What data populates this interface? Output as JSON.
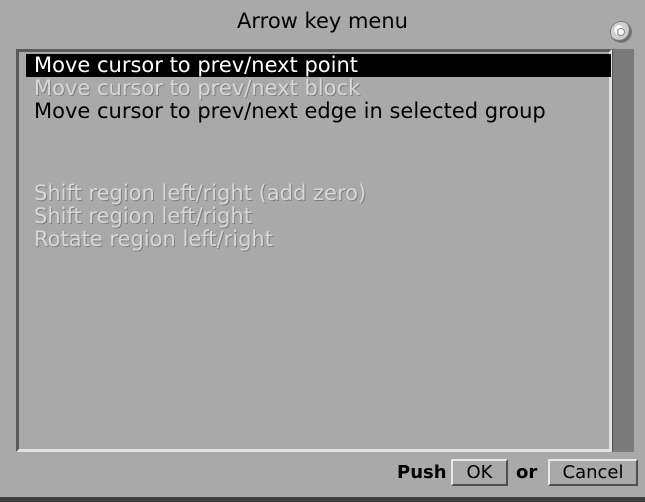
{
  "window": {
    "title": "Arrow key menu"
  },
  "menu": {
    "items": [
      {
        "label": "Move cursor to prev/next point",
        "state": "selected"
      },
      {
        "label": "Move cursor to prev/next block",
        "state": "disabled"
      },
      {
        "label": "Move cursor to prev/next edge in selected group",
        "state": "enabled"
      },
      {
        "label": "Shift region left/right (add zero)",
        "state": "disabled"
      },
      {
        "label": "Shift region left/right",
        "state": "disabled"
      },
      {
        "label": "Rotate region left/right",
        "state": "disabled"
      }
    ]
  },
  "footer": {
    "push_label": "Push",
    "ok_label": "OK",
    "or_label": "or",
    "cancel_label": "Cancel"
  }
}
